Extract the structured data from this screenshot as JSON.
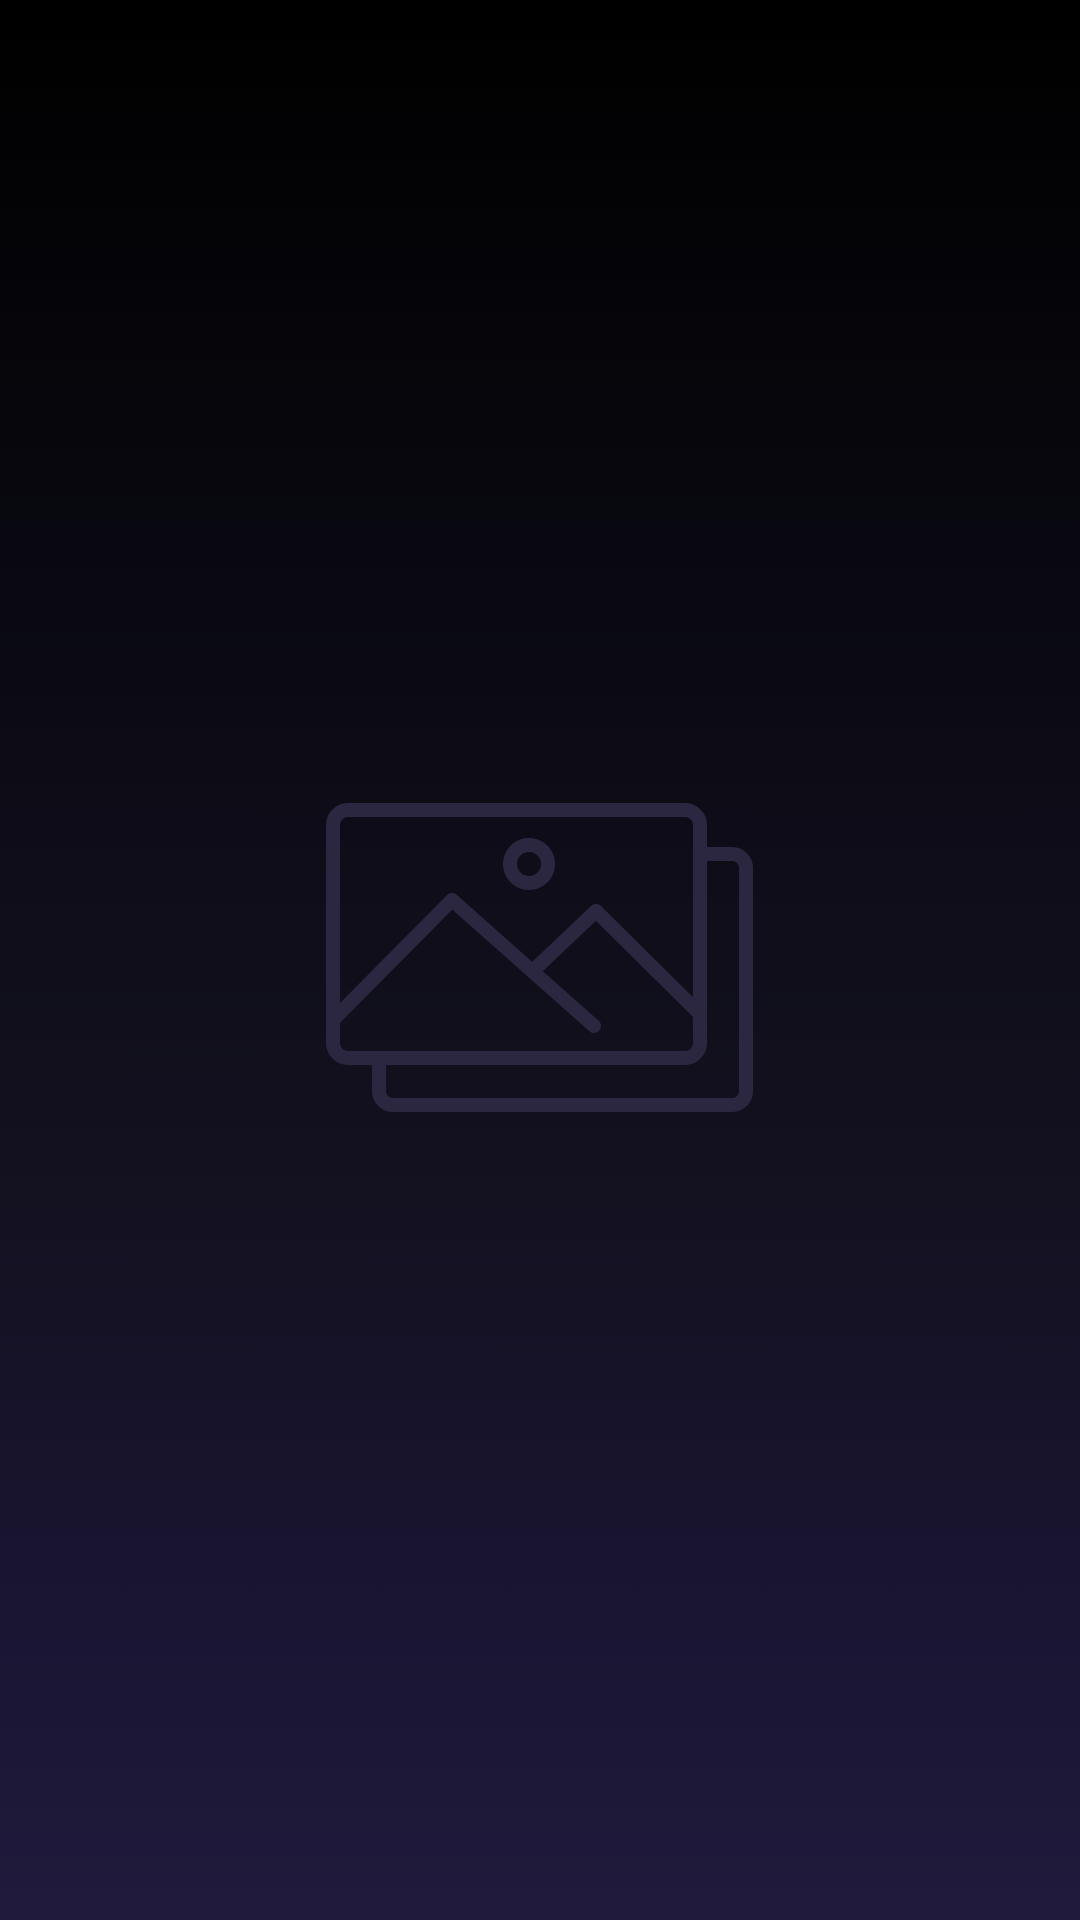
{
  "screen": {
    "state": "empty-image-placeholder",
    "icon": "images-icon",
    "colors": {
      "background_top": "#000000",
      "background_bottom": "#201a3c",
      "icon_stroke": "#2b2740"
    }
  }
}
